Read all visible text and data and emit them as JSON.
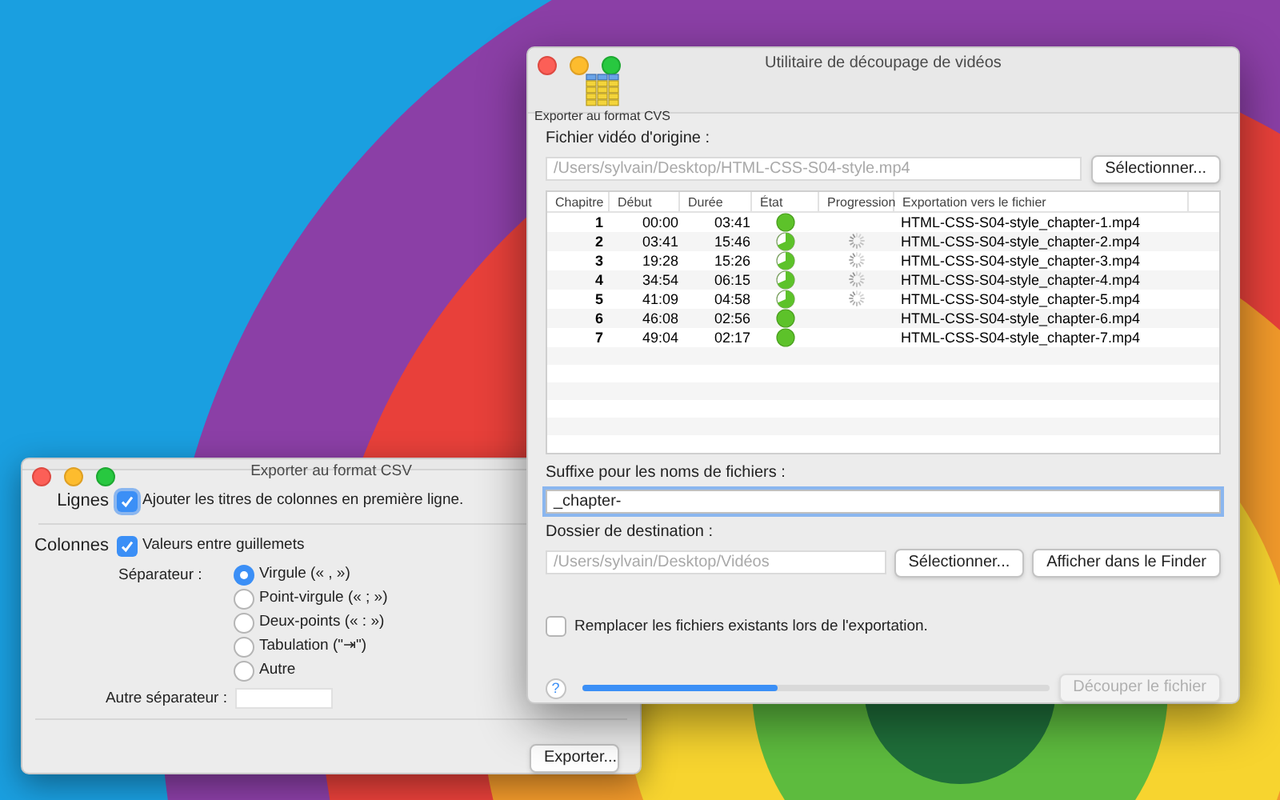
{
  "main_window": {
    "title": "Utilitaire de découpage de vidéos",
    "toolbar": [
      {
        "label": "Exporter au format CVS"
      }
    ],
    "source": {
      "label": "Fichier vidéo d'origine :",
      "value": "/Users/sylvain/Desktop/HTML-CSS-S04-style.mp4",
      "disabled": true,
      "button": "Sélectionner..."
    },
    "table": {
      "columns": [
        "Chapitre",
        "Début",
        "Durée",
        "État",
        "Progression",
        "Exportation vers le fichier"
      ],
      "rows": [
        {
          "chapter": "1",
          "start": "00:00",
          "duration": "03:41",
          "complete": true,
          "busy": false,
          "file": "HTML-CSS-S04-style_chapter-1.mp4"
        },
        {
          "chapter": "2",
          "start": "03:41",
          "duration": "15:46",
          "complete": false,
          "busy": true,
          "file": "HTML-CSS-S04-style_chapter-2.mp4"
        },
        {
          "chapter": "3",
          "start": "19:28",
          "duration": "15:26",
          "complete": false,
          "busy": true,
          "file": "HTML-CSS-S04-style_chapter-3.mp4"
        },
        {
          "chapter": "4",
          "start": "34:54",
          "duration": "06:15",
          "complete": false,
          "busy": true,
          "file": "HTML-CSS-S04-style_chapter-4.mp4"
        },
        {
          "chapter": "5",
          "start": "41:09",
          "duration": "04:58",
          "complete": false,
          "busy": true,
          "file": "HTML-CSS-S04-style_chapter-5.mp4"
        },
        {
          "chapter": "6",
          "start": "46:08",
          "duration": "02:56",
          "complete": true,
          "busy": false,
          "file": "HTML-CSS-S04-style_chapter-6.mp4"
        },
        {
          "chapter": "7",
          "start": "49:04",
          "duration": "02:17",
          "complete": true,
          "busy": false,
          "file": "HTML-CSS-S04-style_chapter-7.mp4"
        }
      ]
    },
    "suffix": {
      "label": "Suffixe pour les noms de fichiers :",
      "value": "_chapter-"
    },
    "destination": {
      "label": "Dossier de destination :",
      "value": "/Users/sylvain/Desktop/Vidéos",
      "disabled": true,
      "buttons": [
        "Sélectionner...",
        "Afficher dans le Finder"
      ]
    },
    "replace": {
      "label": "Remplacer les fichiers existants lors de l'exportation.",
      "checked": false
    },
    "help": "?",
    "progress": {
      "level": 0.42
    },
    "cut_button": {
      "label": "Découper le fichier",
      "disabled": true
    }
  },
  "csv_window": {
    "title": "Exporter au format CSV",
    "lines": {
      "label": "Lignes",
      "option": {
        "label": "Ajouter les titres de colonnes en première ligne.",
        "checked": true
      }
    },
    "columns": {
      "label": "Colonnes",
      "option": {
        "label": "Valeurs entre guillemets",
        "checked": true
      }
    },
    "separator": {
      "label": "Séparateur :",
      "options": [
        {
          "label": "Virgule (« , »)",
          "selected": true
        },
        {
          "label": "Point-virgule (« ; »)",
          "selected": false
        },
        {
          "label": "Deux-points (« : »)",
          "selected": false
        },
        {
          "label": "Tabulation (\"⇥\")",
          "selected": false
        },
        {
          "label": "Autre",
          "selected": false
        }
      ]
    },
    "other": {
      "label": "Autre séparateur :"
    },
    "export_button": "Exporter..."
  }
}
